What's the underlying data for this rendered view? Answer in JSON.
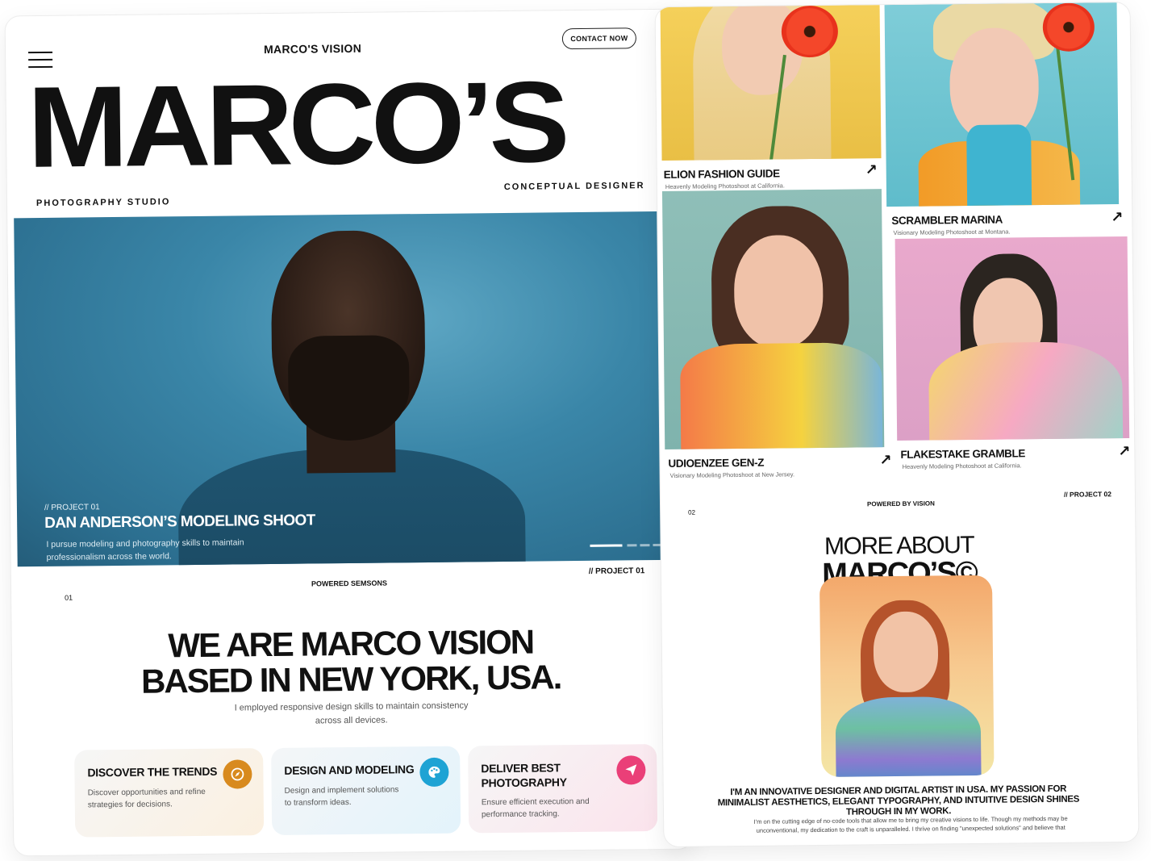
{
  "left": {
    "nav": {
      "brand": "MARCO'S VISION",
      "contact": "CONTACT NOW"
    },
    "hero": {
      "title": "MARCO’S",
      "subtitle_left": "PHOTOGRAPHY STUDIO",
      "subtitle_right": "CONCEPTUAL DESIGNER"
    },
    "feature": {
      "tag": "// PROJECT 01",
      "caption": "DAN ANDERSON’S MODELING SHOOT",
      "desc": "I pursue modeling and photography skills to maintain professionalism across the world."
    },
    "footer_bar": {
      "num": "01",
      "powered": "POWERED SEMSONS",
      "project": "// PROJECT 01"
    },
    "about": {
      "line1": "WE ARE MARCO VISION",
      "line2": "BASED IN NEW YORK, USA.",
      "desc": "I employed responsive design skills to maintain consistency across all devices."
    },
    "cards": [
      {
        "title": "DISCOVER THE TRENDS",
        "desc": "Discover opportunities and refine strategies for decisions.",
        "icon": "compass-icon",
        "color": "#d88a1e"
      },
      {
        "title": "DESIGN AND MODELING",
        "desc": "Design and implement solutions to transform ideas.",
        "icon": "palette-icon",
        "color": "#1ea3d4"
      },
      {
        "title": "DELIVER BEST PHOTOGRAPHY",
        "desc": "Ensure efficient execution and performance tracking.",
        "icon": "send-icon",
        "color": "#ea3f78"
      }
    ]
  },
  "right": {
    "tiles": [
      {
        "title": "ELION FASHION GUIDE",
        "sub": "Heavenly Modeling Photoshoot at California."
      },
      {
        "title": "SCRAMBLER MARINA",
        "sub": "Visionary Modeling Photoshoot at Montana."
      },
      {
        "title": "UDIOENZEE GEN-Z",
        "sub": "Visionary Modeling Photoshoot at New Jersey."
      },
      {
        "title": "FLAKESTAKE GRAMBLE",
        "sub": "Heavenly Modeling Photoshoot at California."
      }
    ],
    "bar": {
      "num": "02",
      "powered": "POWERED BY VISION",
      "project": "// PROJECT 02"
    },
    "more": {
      "line1": "MORE ABOUT",
      "line2": "MARCO’S©"
    },
    "about_heading": "I'M AN INNOVATIVE DESIGNER AND DIGITAL ARTIST IN USA. MY PASSION FOR MINIMALIST AESTHETICS, ELEGANT TYPOGRAPHY, AND INTUITIVE DESIGN SHINES THROUGH IN MY WORK.",
    "about_text": "I'm on the cutting edge of no-code tools that allow me to bring my creative visions to life. Though my methods may be unconventional, my dedication to the craft is unparalleled. I thrive on finding \"unexpected solutions\" and believe that"
  }
}
